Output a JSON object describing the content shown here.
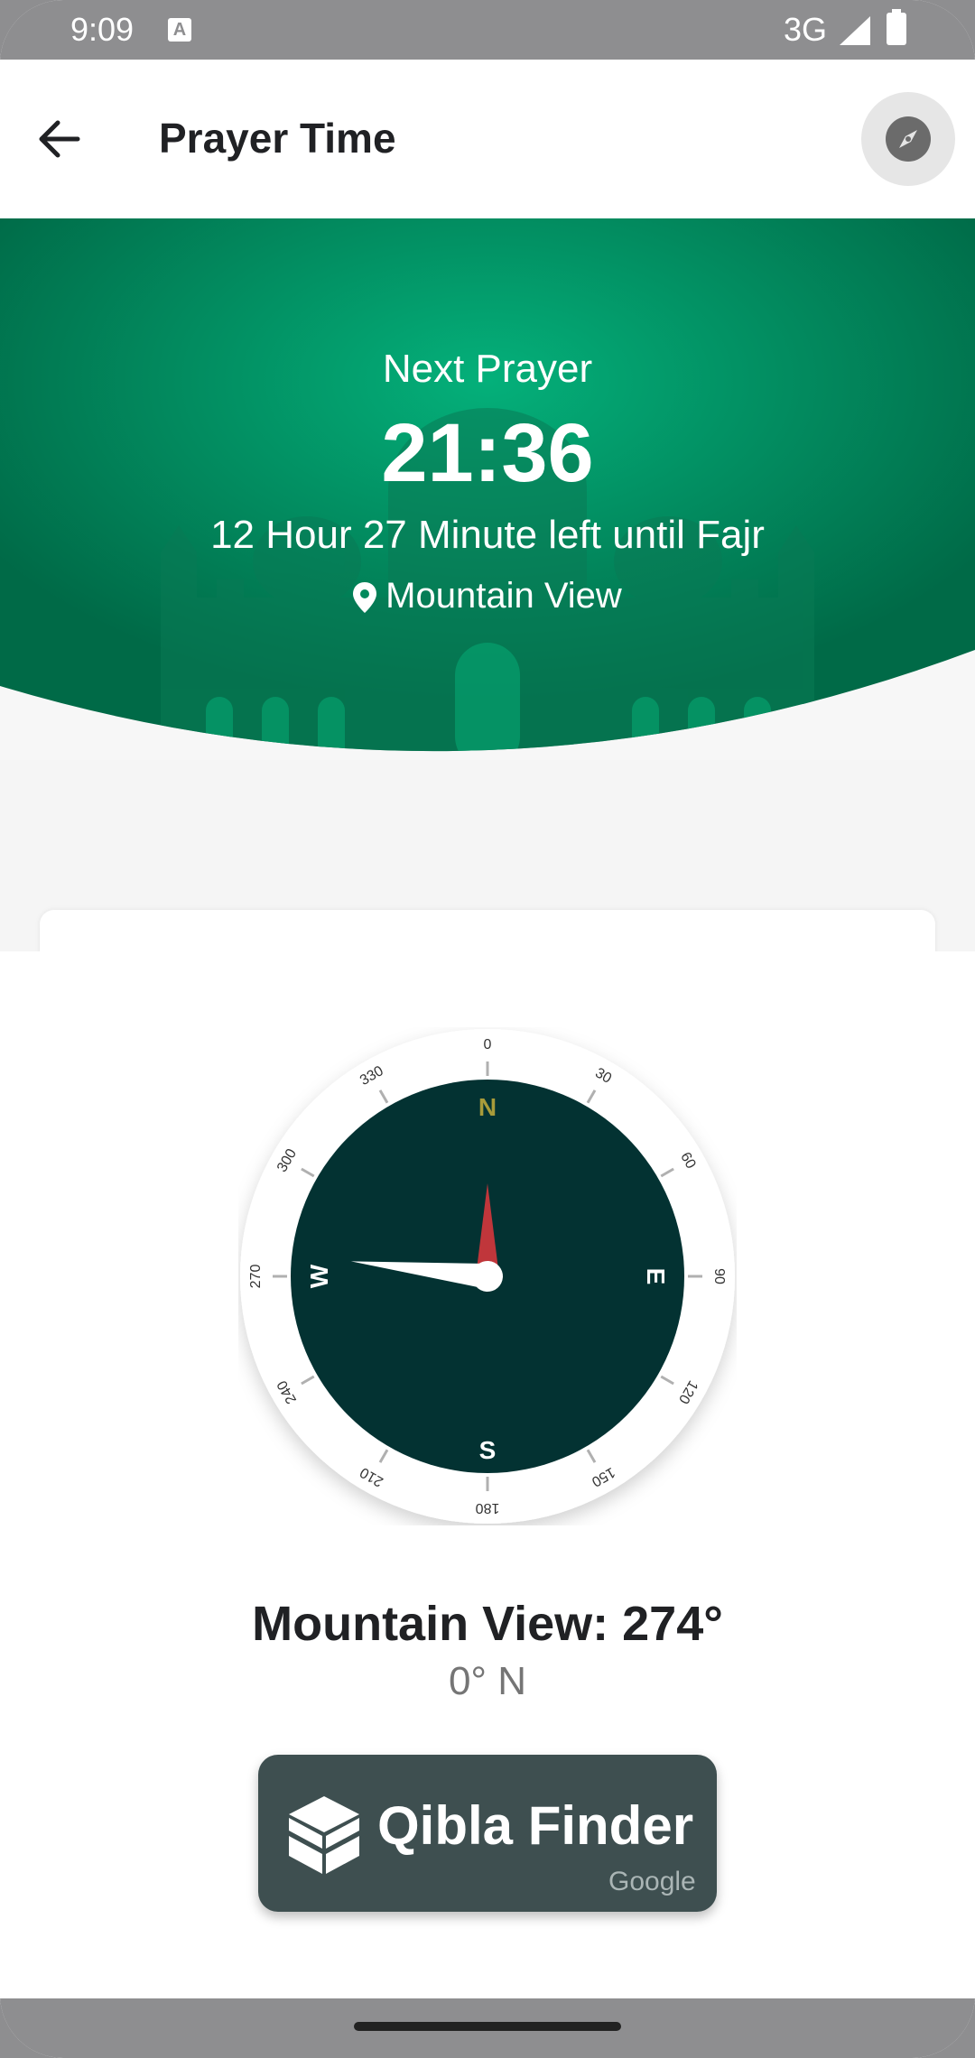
{
  "status_bar": {
    "time": "9:09",
    "network": "3G"
  },
  "app_bar": {
    "title": "Prayer Time"
  },
  "hero": {
    "heading": "Next Prayer",
    "time": "21:36",
    "countdown": "12 Hour 27 Minute left until Fajr",
    "location": "Mountain View"
  },
  "compass": {
    "cardinals": {
      "north": "N",
      "east": "E",
      "south": "S",
      "west": "W"
    },
    "ticks": [
      "0",
      "30",
      "60",
      "90",
      "120",
      "150",
      "180",
      "210",
      "240",
      "270",
      "300",
      "330"
    ],
    "qibla_bearing_deg": 274,
    "colors": {
      "dial": "#033232",
      "ring": "#ffffff",
      "north_label": "#a89b3a",
      "needle_red": "#c0363b"
    }
  },
  "readout": {
    "location_bearing": "Mountain View: 274°",
    "heading": "0° N"
  },
  "qibla_button": {
    "label": "Qibla Finder",
    "brand": "Google"
  },
  "colors": {
    "hero_green": "#00875a",
    "status_gray": "#8e8e90",
    "button_dark": "#3e4f50"
  }
}
